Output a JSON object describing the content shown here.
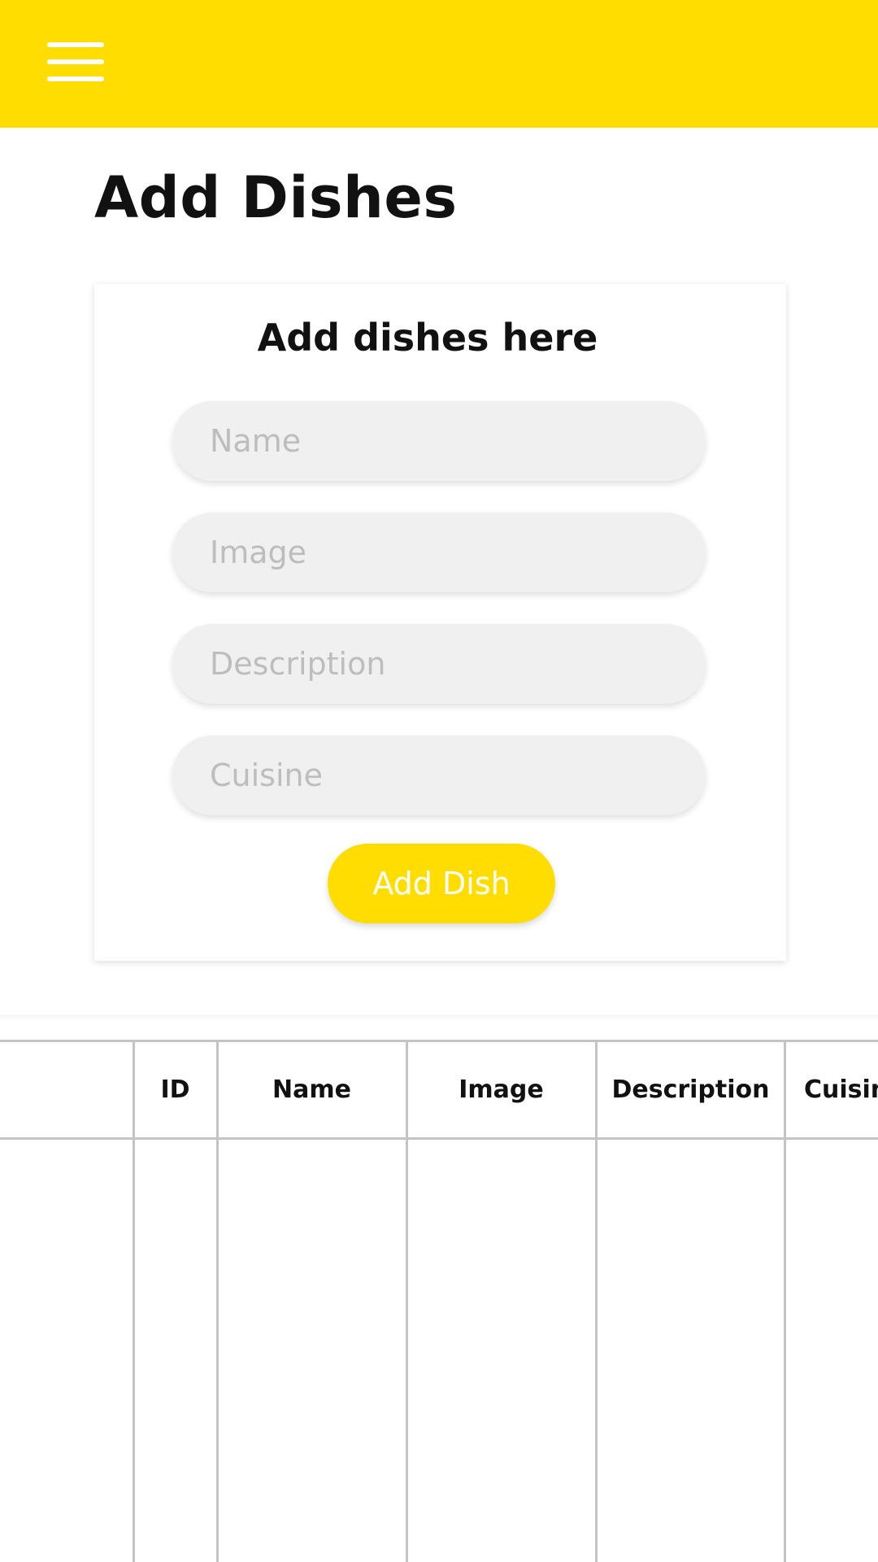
{
  "header": {
    "menu_icon": "hamburger-menu-icon",
    "accent_color": "#FFDD00"
  },
  "page": {
    "title": "Add Dishes"
  },
  "form": {
    "title": "Add dishes here",
    "fields": [
      {
        "placeholder": "Name",
        "value": ""
      },
      {
        "placeholder": "Image",
        "value": ""
      },
      {
        "placeholder": "Description",
        "value": ""
      },
      {
        "placeholder": "Cuisine",
        "value": ""
      }
    ],
    "submit_label": "Add Dish"
  },
  "table": {
    "columns": [
      "",
      "ID",
      "Name",
      "Image",
      "Description",
      "Cuisine"
    ],
    "rows": []
  }
}
